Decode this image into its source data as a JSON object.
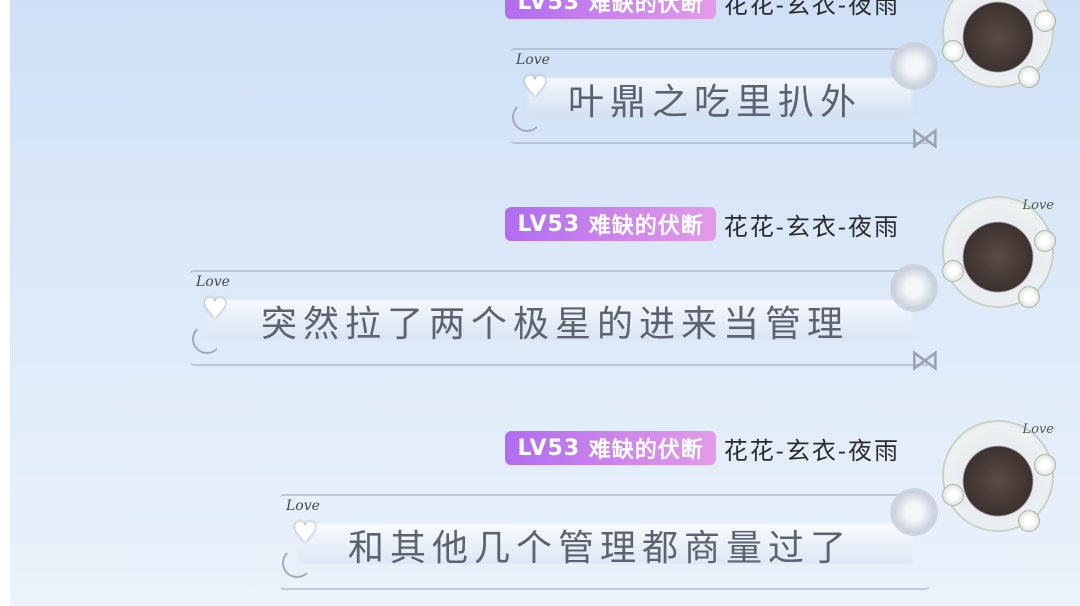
{
  "messages": [
    {
      "level": "LV53",
      "title": "难缺的伏断",
      "sender": "花花-玄衣-夜雨",
      "text": "叶鼎之吃里扒外"
    },
    {
      "level": "LV53",
      "title": "难缺的伏断",
      "sender": "花花-玄衣-夜雨",
      "text": "突然拉了两个极星的进来当管理"
    },
    {
      "level": "LV53",
      "title": "难缺的伏断",
      "sender": "花花-玄衣-夜雨",
      "text": "和其他几个管理都商量过了"
    }
  ],
  "decor": {
    "love_label": "Love",
    "avatar_label": "Love"
  },
  "colors": {
    "badge_start": "#b16cf0",
    "badge_end": "#e39be8",
    "bubble_text": "#5d6270",
    "background_top": "#cfe0f6"
  }
}
